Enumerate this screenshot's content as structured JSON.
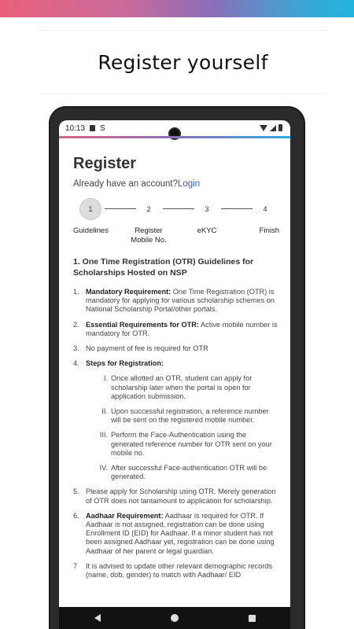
{
  "promo": {
    "title": "Register yourself"
  },
  "status_bar": {
    "time": "10:13",
    "sim_icon": "sim-card-icon",
    "s_glyph": "S"
  },
  "register": {
    "title": "Register",
    "account_prompt": "Already have an account?",
    "login_label": "Login"
  },
  "stepper": {
    "steps": [
      {
        "number": "1",
        "label": "Guidelines",
        "active": true
      },
      {
        "number": "2",
        "label": "Register Mobile No.",
        "active": false
      },
      {
        "number": "3",
        "label": "eKYC",
        "active": false
      },
      {
        "number": "4",
        "label": "Finish",
        "active": false
      }
    ]
  },
  "guidelines": {
    "title": "1. One Time Registration (OTR) Guidelines for Scholarships Hosted on NSP",
    "items": [
      {
        "num": "1.",
        "bold": "Mandatory Requirement:",
        "text": " One Time Registration (OTR) is mandatory for applying for various scholarship schemes on National Scholarship Portal/other portals."
      },
      {
        "num": "2.",
        "bold": "Essential Requirements for OTR:",
        "text": " Active mobile number is mandatory for OTR."
      },
      {
        "num": "3.",
        "bold": "",
        "text": "No payment of fee is required for OTR"
      },
      {
        "num": "4.",
        "bold": "Steps for Registration:",
        "text": ""
      },
      {
        "num": "5.",
        "bold": "",
        "text": "Please apply for Scholarship using OTR. Merely generation of OTR does not tantamount to application for scholarship."
      },
      {
        "num": "6.",
        "bold": "Aadhaar Requirement:",
        "text": " Aadhaar is required for OTR. If Aadhaar is not assigned, registration can be done using Enrollment ID (EID) for Aadhaar. If a minor student has not been assigned Aadhaar yet, registration can be done using Aadhaar of her parent or legal guardian."
      },
      {
        "num": "7",
        "bold": "",
        "text": "It is advised to update other relevant demographic records (name, dob, gender) to match with Aadhaar/ EID"
      }
    ],
    "sub_steps": [
      {
        "num": "I.",
        "text": "Once allotted an OTR, student can apply for scholarship later when the portal is open for application submission."
      },
      {
        "num": "II.",
        "text": "Upon successful registration, a reference number will be sent on the registered mobile number."
      },
      {
        "num": "III.",
        "text": "Perform the Face-Authentication using the generated reference number for OTR sent on your mobile no."
      },
      {
        "num": "IV.",
        "text": "After successful Face-authentication OTR will be generated."
      }
    ]
  },
  "nav": {
    "back": "back-icon",
    "home": "home-icon",
    "recent": "recent-apps-icon"
  }
}
